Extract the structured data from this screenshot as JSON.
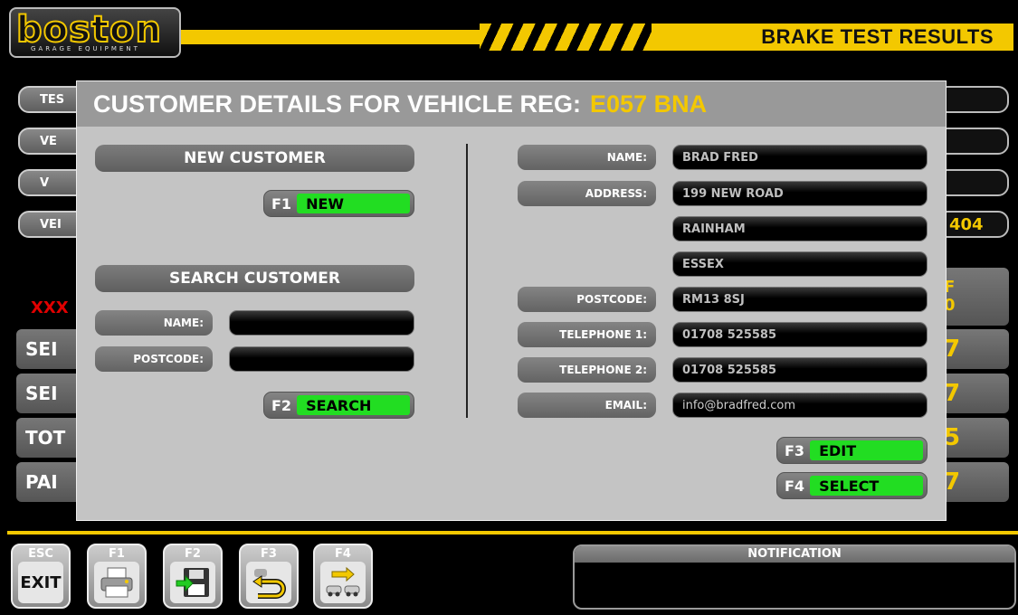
{
  "header": {
    "logo_main": "boston",
    "logo_sub": "GARAGE EQUIPMENT",
    "title": "BRAKE TEST RESULTS"
  },
  "background": {
    "left_pills": [
      "TES",
      "VE",
      "V",
      "VEI"
    ],
    "right_value": "404",
    "xxx": "XXX",
    "rows": [
      "SEI",
      "SEI",
      "TOT",
      "PAI"
    ],
    "right_rows": [
      "F\n0",
      "7",
      "7",
      "5",
      "7"
    ]
  },
  "modal": {
    "title_prefix": "CUSTOMER DETAILS FOR VEHICLE REG:",
    "reg": "E057 BNA",
    "new_customer": "NEW CUSTOMER",
    "f1_key": "F1",
    "f1_label": "NEW",
    "search_customer": "SEARCH CUSTOMER",
    "search_name_label": "NAME:",
    "search_name_value": "",
    "search_postcode_label": "POSTCODE:",
    "search_postcode_value": "",
    "f2_key": "F2",
    "f2_label": "SEARCH",
    "details": {
      "name_label": "NAME:",
      "name": "BRAD FRED",
      "address_label": "ADDRESS:",
      "address1": "199 NEW ROAD",
      "address2": "RAINHAM",
      "address3": "ESSEX",
      "postcode_label": "POSTCODE:",
      "postcode": "RM13 8SJ",
      "tel1_label": "TELEPHONE 1:",
      "tel1": "01708 525585",
      "tel2_label": "TELEPHONE 2:",
      "tel2": "01708 525585",
      "email_label": "EMAIL:",
      "email": "info@bradfred.com"
    },
    "f3_key": "F3",
    "f3_label": "EDIT",
    "f4_key": "F4",
    "f4_label": "SELECT"
  },
  "toolbar": {
    "esc_key": "ESC",
    "esc_label": "EXIT",
    "f1_key": "F1",
    "f2_key": "F2",
    "f3_key": "F3",
    "f4_key": "F4",
    "icons": [
      "printer-icon",
      "save-disk-icon",
      "return-icon",
      "next-vehicle-icon"
    ]
  },
  "notification": {
    "title": "NOTIFICATION",
    "text": ""
  },
  "colors": {
    "accent": "#f3c800",
    "button_green": "#22dd22",
    "alert_red": "#e00000"
  }
}
